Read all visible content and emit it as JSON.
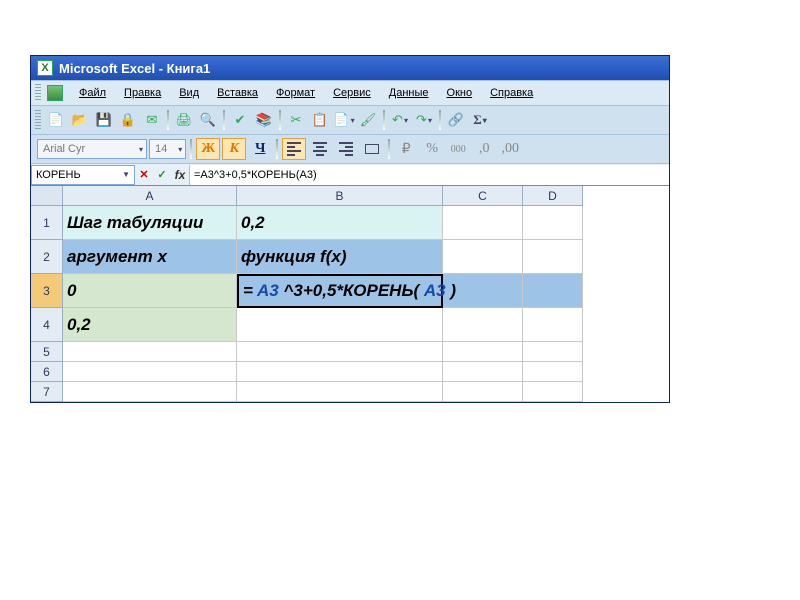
{
  "title": "Microsoft Excel - Книга1",
  "menu": {
    "file": "Файл",
    "edit": "Правка",
    "view": "Вид",
    "insert": "Вставка",
    "format": "Формат",
    "tools": "Сервис",
    "data": "Данные",
    "window": "Окно",
    "help": "Справка"
  },
  "font": {
    "name": "Arial Cyr",
    "size": "14",
    "bold_label": "Ж",
    "italic_label": "К",
    "underline_label": "Ч"
  },
  "formula_bar": {
    "name_box": "КОРЕНЬ",
    "formula": "=A3^3+0,5*КОРЕНЬ(A3)"
  },
  "columns": [
    "A",
    "B",
    "C",
    "D"
  ],
  "rows": [
    "1",
    "2",
    "3",
    "4",
    "5",
    "6",
    "7"
  ],
  "cells": {
    "A1": "Шаг табуляции",
    "B1": "0,2",
    "A2": "аргумент x",
    "B2": "функция f(x)",
    "A3": "0",
    "B3_parts": {
      "p1": "= ",
      "r1": "A3",
      "p2": " ^3+0,5*КОРЕНЬ( ",
      "r2": "A3",
      "p3": " )"
    },
    "A4": "0,2"
  }
}
